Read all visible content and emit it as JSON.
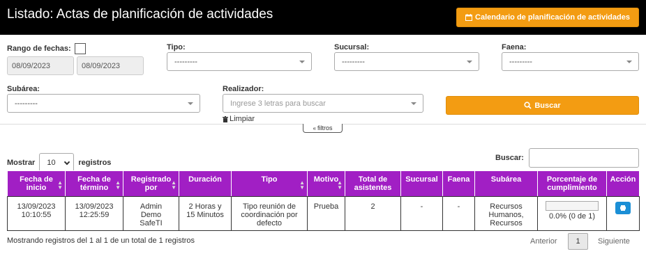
{
  "header": {
    "title": "Listado: Actas de planificación de actividades",
    "calendar_button": "Calendario de planificación de actividades"
  },
  "filters": {
    "date_range_label": "Rango de fechas:",
    "date_from": "08/09/2023",
    "date_to": "08/09/2023",
    "tipo_label": "Tipo:",
    "tipo_value": "---------",
    "sucursal_label": "Sucursal:",
    "sucursal_value": "---------",
    "faena_label": "Faena:",
    "faena_value": "---------",
    "subarea_label": "Subárea:",
    "subarea_value": "---------",
    "realizador_label": "Realizador:",
    "realizador_placeholder": "Ingrese 3 letras para buscar",
    "search_button": "Buscar",
    "clear_link": "Limpiar",
    "toggle_filters": "filtros"
  },
  "table_controls": {
    "show_label": "Mostrar",
    "page_length": "10",
    "records_label": "registros",
    "search_label": "Buscar:"
  },
  "table": {
    "columns": [
      "Fecha de inicio",
      "Fecha de término",
      "Registrado por",
      "Duración",
      "Tipo",
      "Motivo",
      "Total de asistentes",
      "Sucursal",
      "Faena",
      "Subárea",
      "Porcentaje de cumplimiento",
      "Acción"
    ],
    "rows": [
      {
        "fecha_inicio": "13/09/2023 10:10:55",
        "fecha_termino": "13/09/2023 12:25:59",
        "registrado_por": "Admin Demo SafeTI",
        "duracion": "2 Horas y 15 Minutos",
        "tipo": "Tipo reunión de coordinación por defecto",
        "motivo": "Prueba",
        "total_asistentes": "2",
        "sucursal": "-",
        "faena": "-",
        "subarea": "Recursos Humanos, Recursos",
        "cumplimiento_text": "0.0% (0 de 1)",
        "cumplimiento_fraction": 0.0
      }
    ]
  },
  "footer": {
    "info": "Mostrando registros del 1 al 1 de un total de 1 registros",
    "prev": "Anterior",
    "page": "1",
    "next": "Siguiente"
  },
  "colors": {
    "accent_orange": "#f39c12",
    "table_header": "#a11fc4",
    "print_button": "#1b8fd6"
  }
}
